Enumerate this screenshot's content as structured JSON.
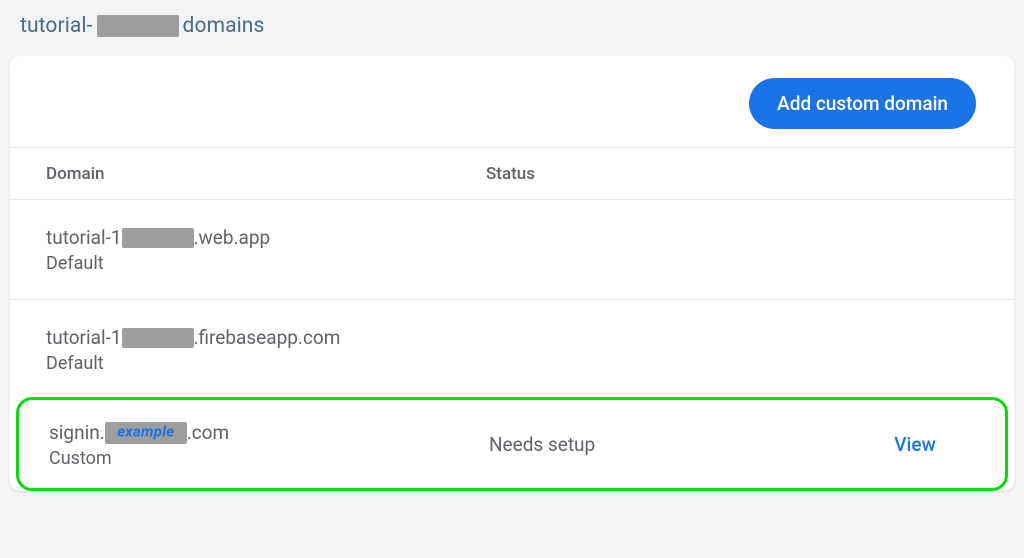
{
  "title": {
    "prefix": "tutorial-",
    "suffix": " domains"
  },
  "toolbar": {
    "add_btn": "Add custom domain"
  },
  "columns": {
    "domain": "Domain",
    "status": "Status"
  },
  "rows": [
    {
      "name_prefix": "tutorial-1",
      "name_suffix": ".web.app",
      "type": "Default",
      "status": "",
      "action": "",
      "redact_label": ""
    },
    {
      "name_prefix": "tutorial-1",
      "name_suffix": ".firebaseapp.com",
      "type": "Default",
      "status": "",
      "action": "",
      "redact_label": ""
    },
    {
      "name_prefix": "signin.",
      "name_suffix": ".com",
      "type": "Custom",
      "status": "Needs setup",
      "action": "View",
      "redact_label": "example"
    }
  ]
}
